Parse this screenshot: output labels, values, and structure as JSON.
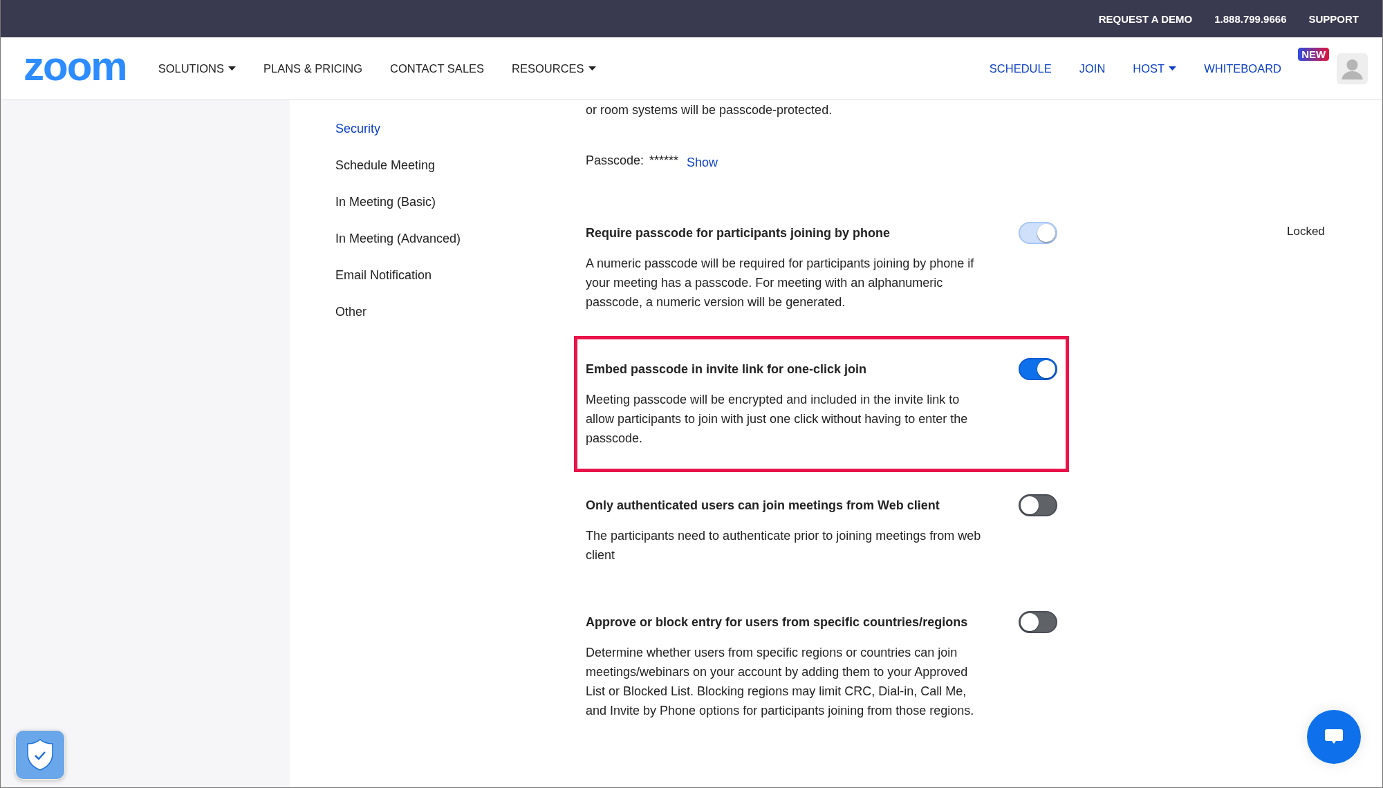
{
  "top_bar": {
    "links": [
      "REQUEST A DEMO",
      "1.888.799.9666",
      "SUPPORT"
    ]
  },
  "header": {
    "logo": "zoom",
    "nav_left": [
      {
        "label": "SOLUTIONS",
        "dropdown": true
      },
      {
        "label": "PLANS & PRICING",
        "dropdown": false
      },
      {
        "label": "CONTACT SALES",
        "dropdown": false
      },
      {
        "label": "RESOURCES",
        "dropdown": true
      }
    ],
    "nav_right": [
      {
        "label": "SCHEDULE",
        "dropdown": false
      },
      {
        "label": "JOIN",
        "dropdown": false
      },
      {
        "label": "HOST",
        "dropdown": true
      },
      {
        "label": "WHITEBOARD",
        "dropdown": false,
        "badge": "NEW"
      }
    ]
  },
  "sidebar": {
    "items": [
      {
        "label": "Security",
        "selected": true
      },
      {
        "label": "Schedule Meeting",
        "selected": false
      },
      {
        "label": "In Meeting (Basic)",
        "selected": false
      },
      {
        "label": "In Meeting (Advanced)",
        "selected": false
      },
      {
        "label": "Email Notification",
        "selected": false
      },
      {
        "label": "Other",
        "selected": false
      }
    ]
  },
  "pmi": {
    "description": "or room systems will be passcode-protected.",
    "passcode_label": "Passcode:",
    "passcode_value": "******",
    "show_link": "Show"
  },
  "settings": [
    {
      "title": "Require passcode for participants joining by phone",
      "description": "A numeric passcode will be required for participants joining by phone if your meeting has a passcode. For meeting with an alphanumeric passcode, a numeric version will be generated.",
      "on": true,
      "locked": true,
      "locked_label": "Locked"
    },
    {
      "title": "Embed passcode in invite link for one-click join",
      "description": "Meeting passcode will be encrypted and included in the invite link to allow participants to join with just one click without having to enter the passcode.",
      "on": true,
      "highlighted": true
    },
    {
      "title": "Only authenticated users can join meetings from Web client",
      "description": "The participants need to authenticate prior to joining meetings from web client",
      "on": false
    },
    {
      "title": "Approve or block entry for users from specific countries/regions",
      "description": "Determine whether users from specific regions or countries can join meetings/webinars on your account by adding them to your Approved List or Blocked List. Blocking regions may limit CRC, Dial-in, Call Me, and Invite by Phone options for participants joining from those regions.",
      "on": false
    }
  ]
}
